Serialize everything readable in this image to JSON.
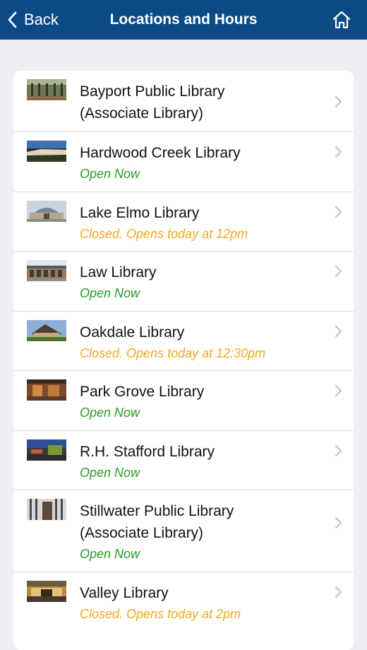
{
  "navbar": {
    "back_label": "Back",
    "title": "Locations and Hours",
    "home_icon": "home-icon",
    "background": "#0c4a86"
  },
  "colors": {
    "open": "#2a9a2a",
    "closed": "#f2a81c"
  },
  "locations": [
    {
      "name": "Bayport Public Library\n(Associate Library)",
      "status": "",
      "status_type": ""
    },
    {
      "name": "Hardwood Creek Library",
      "status": "Open Now",
      "status_type": "open"
    },
    {
      "name": "Lake Elmo Library",
      "status": "Closed. Opens today at 12pm",
      "status_type": "closed"
    },
    {
      "name": "Law Library",
      "status": "Open Now",
      "status_type": "open"
    },
    {
      "name": "Oakdale Library",
      "status": "Closed. Opens today at 12:30pm",
      "status_type": "closed"
    },
    {
      "name": "Park Grove Library",
      "status": "Open Now",
      "status_type": "open"
    },
    {
      "name": "R.H. Stafford Library",
      "status": "Open Now",
      "status_type": "open"
    },
    {
      "name": "Stillwater Public Library\n(Associate Library)",
      "status": "Open Now",
      "status_type": "open"
    },
    {
      "name": "Valley Library",
      "status": "Closed. Opens today at 2pm",
      "status_type": "closed"
    }
  ]
}
